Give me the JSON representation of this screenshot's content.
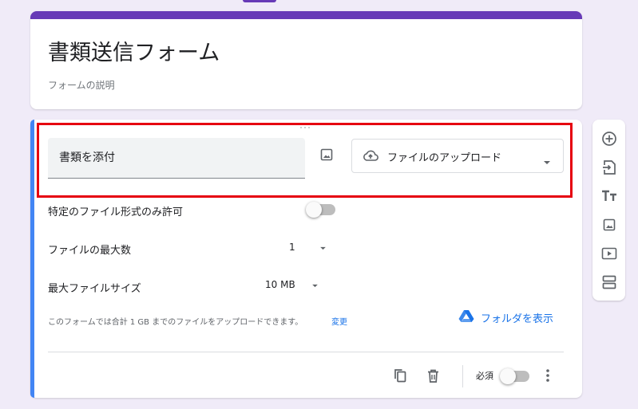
{
  "form": {
    "title": "書類送信フォーム",
    "description": "フォームの説明"
  },
  "question": {
    "title": "書類を添付",
    "type_label": "ファイルのアップロード",
    "type_icon": "cloud-upload-icon",
    "settings": {
      "specific_types_label": "特定のファイル形式のみ許可",
      "specific_types_enabled": false,
      "max_files_label": "ファイルの最大数",
      "max_files_value": "1",
      "max_size_label": "最大ファイルサイズ",
      "max_size_value": "10 MB"
    },
    "info_text": "このフォームでは合計 1 GB までのファイルをアップロードできます。",
    "change_link": "変更",
    "folder_link": "フォルダを表示",
    "required_label": "必須",
    "required_enabled": false
  },
  "footer_icons": [
    "copy-icon",
    "trash-icon",
    "more-vert-icon"
  ],
  "side_toolbar": [
    "add-question-icon",
    "import-questions-icon",
    "add-title-icon",
    "add-image-icon",
    "add-video-icon",
    "add-section-icon"
  ],
  "colors": {
    "background": "#f0ebf8",
    "theme": "#673ab7",
    "accent": "#4285f4",
    "link": "#1a73e8",
    "highlight": "#e6000f"
  }
}
